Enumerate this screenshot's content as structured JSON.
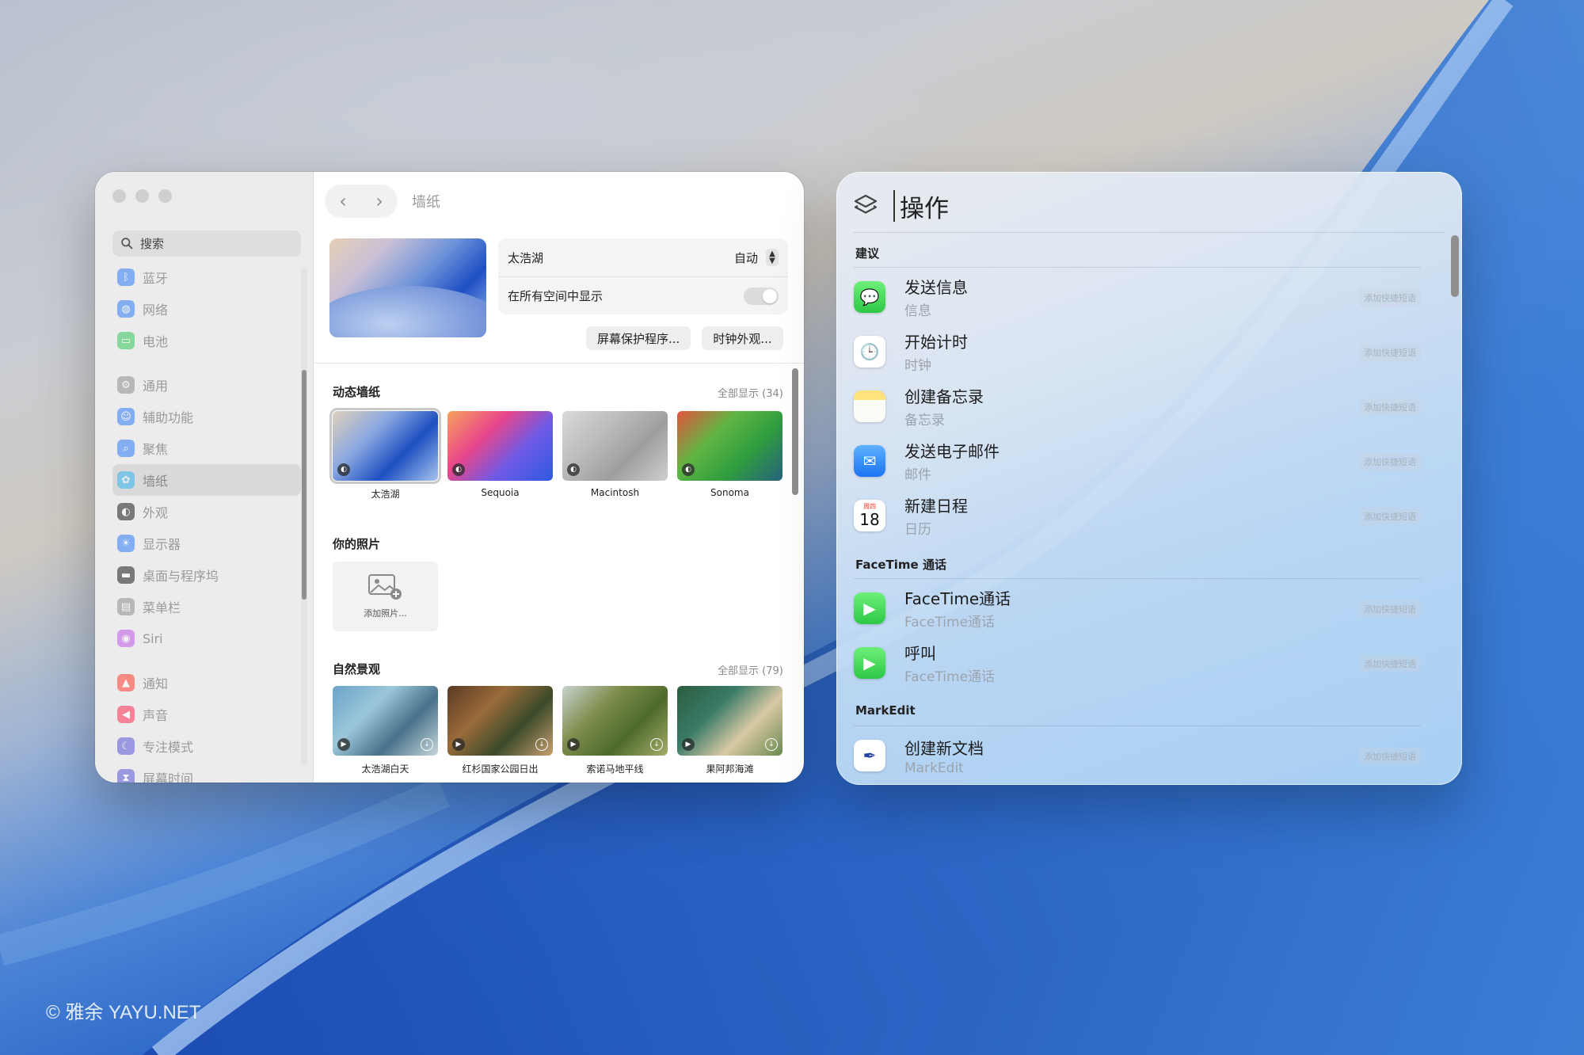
{
  "settings": {
    "toolbar_title": "墙纸",
    "search_placeholder": "搜索",
    "sidebar": [
      {
        "label": "蓝牙",
        "icon": "bluetooth-icon",
        "color": "#2f7cf6"
      },
      {
        "label": "网络",
        "icon": "globe-icon",
        "color": "#2f7cf6"
      },
      {
        "label": "电池",
        "icon": "battery-icon",
        "color": "#34c759"
      },
      {
        "label": "通用",
        "icon": "gear-icon",
        "color": "#8e8e93"
      },
      {
        "label": "辅助功能",
        "icon": "accessibility-icon",
        "color": "#2f7cf6"
      },
      {
        "label": "聚焦",
        "icon": "magnifier-icon",
        "color": "#2f7cf6"
      },
      {
        "label": "墙纸",
        "icon": "flower-icon",
        "color": "#37b5f0"
      },
      {
        "label": "外观",
        "icon": "appearance-icon",
        "color": "#1c1c1e"
      },
      {
        "label": "显示器",
        "icon": "sun-icon",
        "color": "#2f7cf6"
      },
      {
        "label": "桌面与程序坞",
        "icon": "dock-icon",
        "color": "#1c1c1e"
      },
      {
        "label": "菜单栏",
        "icon": "menubar-icon",
        "color": "#8e8e93"
      },
      {
        "label": "Siri",
        "icon": "siri-icon",
        "color": "#c257e6"
      },
      {
        "label": "通知",
        "icon": "bell-icon",
        "color": "#ff3b30"
      },
      {
        "label": "声音",
        "icon": "speaker-icon",
        "color": "#ff2d55"
      },
      {
        "label": "专注模式",
        "icon": "moon-icon",
        "color": "#5856d6"
      },
      {
        "label": "屏幕时间",
        "icon": "hourglass-icon",
        "color": "#5856d6"
      }
    ],
    "current": {
      "name": "太浩湖",
      "mode": "自动",
      "all_spaces_label": "在所有空间中显示"
    },
    "buttons": {
      "screensaver": "屏幕保护程序...",
      "clock": "时钟外观..."
    },
    "dynamic": {
      "title": "动态墙纸",
      "show_all": "全部显示 (34)",
      "items": [
        {
          "label": "太浩湖",
          "colors": [
            "#dfcfbd",
            "#8aa8e0",
            "#1d4fc1",
            "#a7c4ee"
          ]
        },
        {
          "label": "Sequoia",
          "colors": [
            "#f6a25d",
            "#e9458a",
            "#6e5ae6",
            "#2c5be0"
          ]
        },
        {
          "label": "Macintosh",
          "colors": [
            "#d9d9d9",
            "#bcbcbc",
            "#9e9e9e",
            "#cfcfcf"
          ]
        },
        {
          "label": "Sonoma",
          "colors": [
            "#e5543d",
            "#5fb543",
            "#2f9d3f",
            "#27627c"
          ]
        }
      ]
    },
    "photos": {
      "title": "你的照片",
      "add_label": "添加照片..."
    },
    "nature": {
      "title": "自然景观",
      "show_all": "全部显示 (79)",
      "items": [
        {
          "label": "太浩湖白天",
          "colors": [
            "#6aa3c8",
            "#9cc7da",
            "#47718a",
            "#c8d8dc"
          ]
        },
        {
          "label": "红杉国家公园日出",
          "colors": [
            "#5a3a24",
            "#9a6b3a",
            "#3b4a2a",
            "#c9a070"
          ]
        },
        {
          "label": "索诺马地平线",
          "colors": [
            "#c8d2d0",
            "#7d8d4b",
            "#4e6a2c",
            "#a4ad69"
          ]
        },
        {
          "label": "果阿邦海滩",
          "colors": [
            "#2b5d3e",
            "#3a7a68",
            "#d9c9a3",
            "#6b8a50"
          ]
        }
      ]
    }
  },
  "spotlight": {
    "query": "操作",
    "tag_label": "添加快捷短语",
    "groups": [
      {
        "title": "建议",
        "items": [
          {
            "title": "发送信息",
            "sub": "信息",
            "icon": "messages-icon"
          },
          {
            "title": "开始计时",
            "sub": "时钟",
            "icon": "clock-icon"
          },
          {
            "title": "创建备忘录",
            "sub": "备忘录",
            "icon": "notes-icon"
          },
          {
            "title": "发送电子邮件",
            "sub": "邮件",
            "icon": "mail-icon"
          },
          {
            "title": "新建日程",
            "sub": "日历",
            "icon": "calendar-icon",
            "day": "18",
            "month": "周四"
          }
        ]
      },
      {
        "title": "FaceTime 通话",
        "items": [
          {
            "title": "FaceTime通话",
            "sub": "FaceTime通话",
            "icon": "facetime-icon"
          },
          {
            "title": "呼叫",
            "sub": "FaceTime通话",
            "icon": "facetime-icon"
          }
        ]
      },
      {
        "title": "MarkEdit",
        "items": [
          {
            "title": "创建新文档",
            "sub": "MarkEdit",
            "icon": "markedit-icon"
          }
        ]
      }
    ]
  },
  "watermark": "© 雅余 YAYU.NET"
}
